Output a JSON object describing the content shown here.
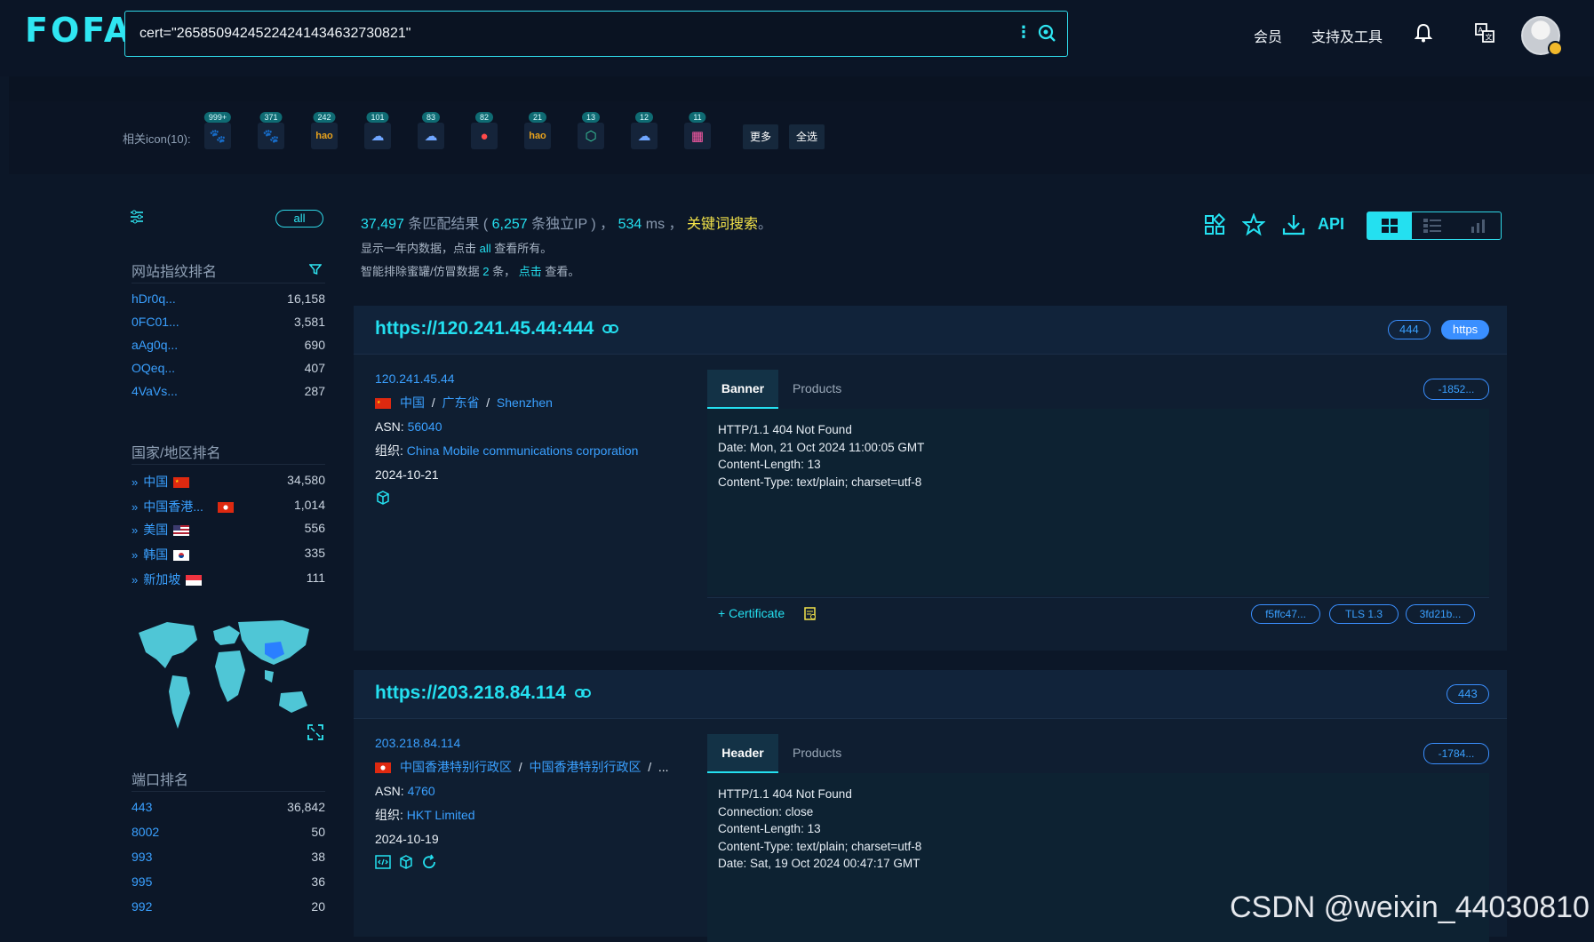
{
  "header": {
    "logo": "FOFA",
    "search_value": "cert=\"265850942452242414346327308­21\"",
    "nav": [
      "会员",
      "支持及工具"
    ]
  },
  "related_icons": {
    "label": "相关icon(10):",
    "items": [
      {
        "badge": "999+",
        "icon": "paw-icon"
      },
      {
        "badge": "371",
        "icon": "paw-icon"
      },
      {
        "badge": "242",
        "icon": "hao-icon"
      },
      {
        "badge": "101",
        "icon": "cloud-paw-icon"
      },
      {
        "badge": "83",
        "icon": "cloud-paw-icon"
      },
      {
        "badge": "82",
        "icon": "map-pin-icon"
      },
      {
        "badge": "21",
        "icon": "hao-icon"
      },
      {
        "badge": "13",
        "icon": "hexagon-icon"
      },
      {
        "badge": "12",
        "icon": "cloud-paw-icon"
      },
      {
        "badge": "11",
        "icon": "tiles-icon"
      }
    ],
    "more": "更多",
    "select_all": "全选"
  },
  "sidebar": {
    "all_label": "all",
    "fingerprint_title": "网站指纹排名",
    "fingerprints": [
      {
        "k": "hDr0q...",
        "v": "16,158"
      },
      {
        "k": "0FC01...",
        "v": "3,581"
      },
      {
        "k": "aAg0q...",
        "v": "690"
      },
      {
        "k": "OQeq...",
        "v": "407"
      },
      {
        "k": "4VaVs...",
        "v": "287"
      }
    ],
    "country_title": "国家/地区排名",
    "countries": [
      {
        "k": "中国",
        "v": "34,580",
        "flag": "cn"
      },
      {
        "k": "中国香港...",
        "v": "1,014",
        "flag": "hk"
      },
      {
        "k": "美国",
        "v": "556",
        "flag": "us"
      },
      {
        "k": "韩国",
        "v": "335",
        "flag": "kr"
      },
      {
        "k": "新加坡",
        "v": "111",
        "flag": "sg"
      }
    ],
    "port_title": "端口排名",
    "ports": [
      {
        "k": "443",
        "v": "36,842"
      },
      {
        "k": "8002",
        "v": "50"
      },
      {
        "k": "993",
        "v": "38"
      },
      {
        "k": "995",
        "v": "36"
      },
      {
        "k": "992",
        "v": "20"
      }
    ]
  },
  "summary": {
    "count": "37,497",
    "t1": " 条匹配结果 ( ",
    "ips": "6,257",
    "t2": " 条独立IP ) ， ",
    "ms": "534",
    "t3": " ms ， ",
    "keyword": "关键词搜索",
    "t4": "。",
    "sub1a": "显示一年内数据，点击 ",
    "sub1b": "all",
    "sub1c": " 查看所有。",
    "sub2a": "智能排除蜜罐/仿冒数据 ",
    "sub2b": "2",
    "sub2c": " 条， ",
    "sub2d": "点击",
    "sub2e": " 查看。",
    "api": "API"
  },
  "results": [
    {
      "url": "https://120.241.45.44:444",
      "pills": [
        "444",
        "https"
      ],
      "ip": "120.241.45.44",
      "country": "中国",
      "region": "广东省",
      "city": "Shenzhen",
      "asn_label": "ASN: ",
      "asn": "56040",
      "org_label": "组织: ",
      "org": "China Mobile communications corporation",
      "date": "2024-10-21",
      "tab_active": "Banner",
      "tab_other": "Products",
      "hash": "-1852...",
      "banner": [
        "HTTP/1.1 404 Not Found",
        "Date: Mon, 21 Oct 2024 11:00:05 GMT",
        "Content-Length: 13",
        "Content-Type: text/plain; charset=utf-8"
      ],
      "cert_label": "Certificate",
      "cert_pills": [
        "f5ffc47...",
        "TLS 1.3",
        "3fd21b..."
      ]
    },
    {
      "url": "https://203.218.84.114",
      "pills": [
        "443"
      ],
      "ip": "203.218.84.114",
      "country": "中国香港特别行政区",
      "region": "中国香港特别行政区",
      "city": "...",
      "asn_label": "ASN: ",
      "asn": "4760",
      "org_label": "组织: ",
      "org": "HKT Limited",
      "date": "2024-10-19",
      "tab_active": "Header",
      "tab_other": "Products",
      "hash": "-1784...",
      "banner": [
        "HTTP/1.1 404 Not Found",
        "Connection: close",
        "Content-Length: 13",
        "Content-Type: text/plain; charset=utf-8",
        "Date: Sat, 19 Oct 2024 00:47:17 GMT"
      ]
    }
  ],
  "watermark": "CSDN @weixin_44030810"
}
